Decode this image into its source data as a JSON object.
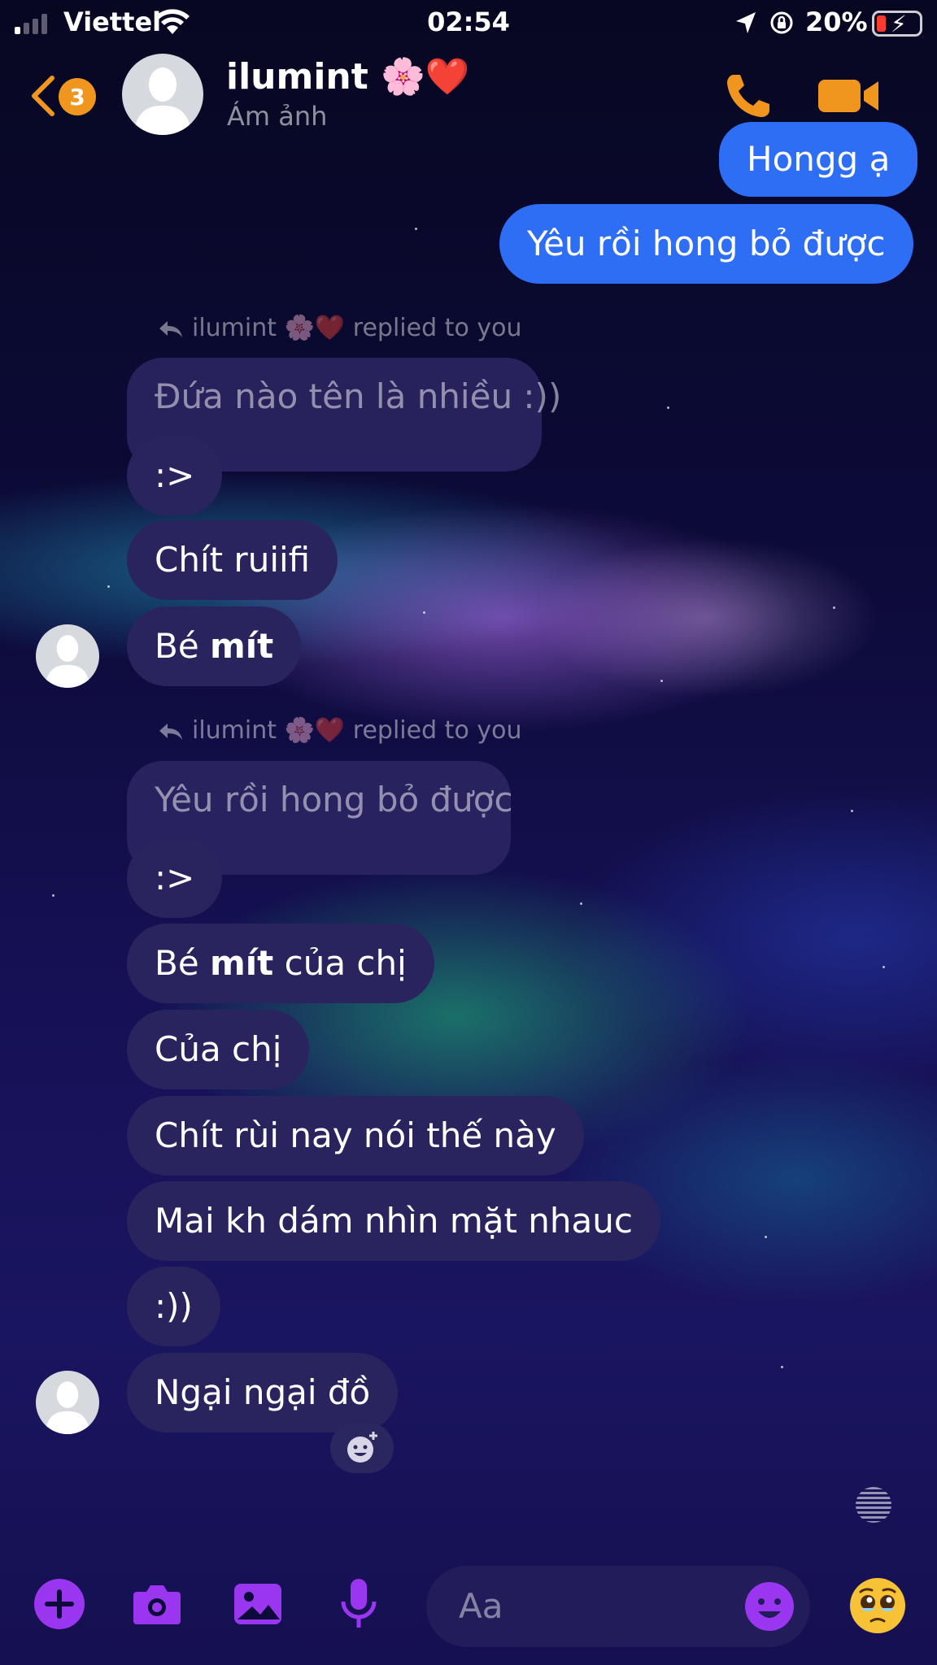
{
  "status_bar": {
    "carrier": "Viettel",
    "time": "02:54",
    "battery_percent": "20%",
    "battery_level": 0.2,
    "signal_bars": 1
  },
  "header": {
    "back_badge": "3",
    "contact_name": "ilumint 🌸❤️",
    "contact_subtitle": "Ám ảnh"
  },
  "messages": {
    "out_1": "Hongg ạ",
    "out_2": "Yêu rồi hong bỏ được",
    "reply_1_label": "ilumint 🌸❤️ replied to you",
    "reply_1_quoted": "Đứa nào tên là nhiều :))",
    "in_1": ":>",
    "in_2": "Chít ruiifi",
    "in_3_prefix": "Bé ",
    "in_3_bold": "mít",
    "reply_2_label": "ilumint 🌸❤️ replied to you",
    "reply_2_quoted": "Yêu rồi hong bỏ được",
    "in_4": ":>",
    "in_5_prefix": "Bé ",
    "in_5_bold": "mít",
    "in_5_suffix": " của chị",
    "in_6": "Của chị",
    "in_7": "Chít rùi nay nói thế này",
    "in_8": "Mai kh dám nhìn mặt nhauc",
    "in_9": ":))",
    "in_10": "Ngại ngại đồ"
  },
  "composer": {
    "placeholder": "Aa",
    "quick_reaction": "🥹"
  },
  "colors": {
    "accent_orange": "#f0961e",
    "accent_purple": "#9b36f0",
    "outgoing_bubble": "#2d6ef5",
    "incoming_bubble": "#29245e"
  },
  "icons": [
    "signal-icon",
    "wifi-icon",
    "location-icon",
    "rotation-lock-icon",
    "battery-icon",
    "back-chevron-icon",
    "phone-icon",
    "video-icon",
    "reply-icon",
    "add-reaction-icon",
    "plus-icon",
    "camera-icon",
    "image-icon",
    "microphone-icon",
    "emoji-icon"
  ]
}
